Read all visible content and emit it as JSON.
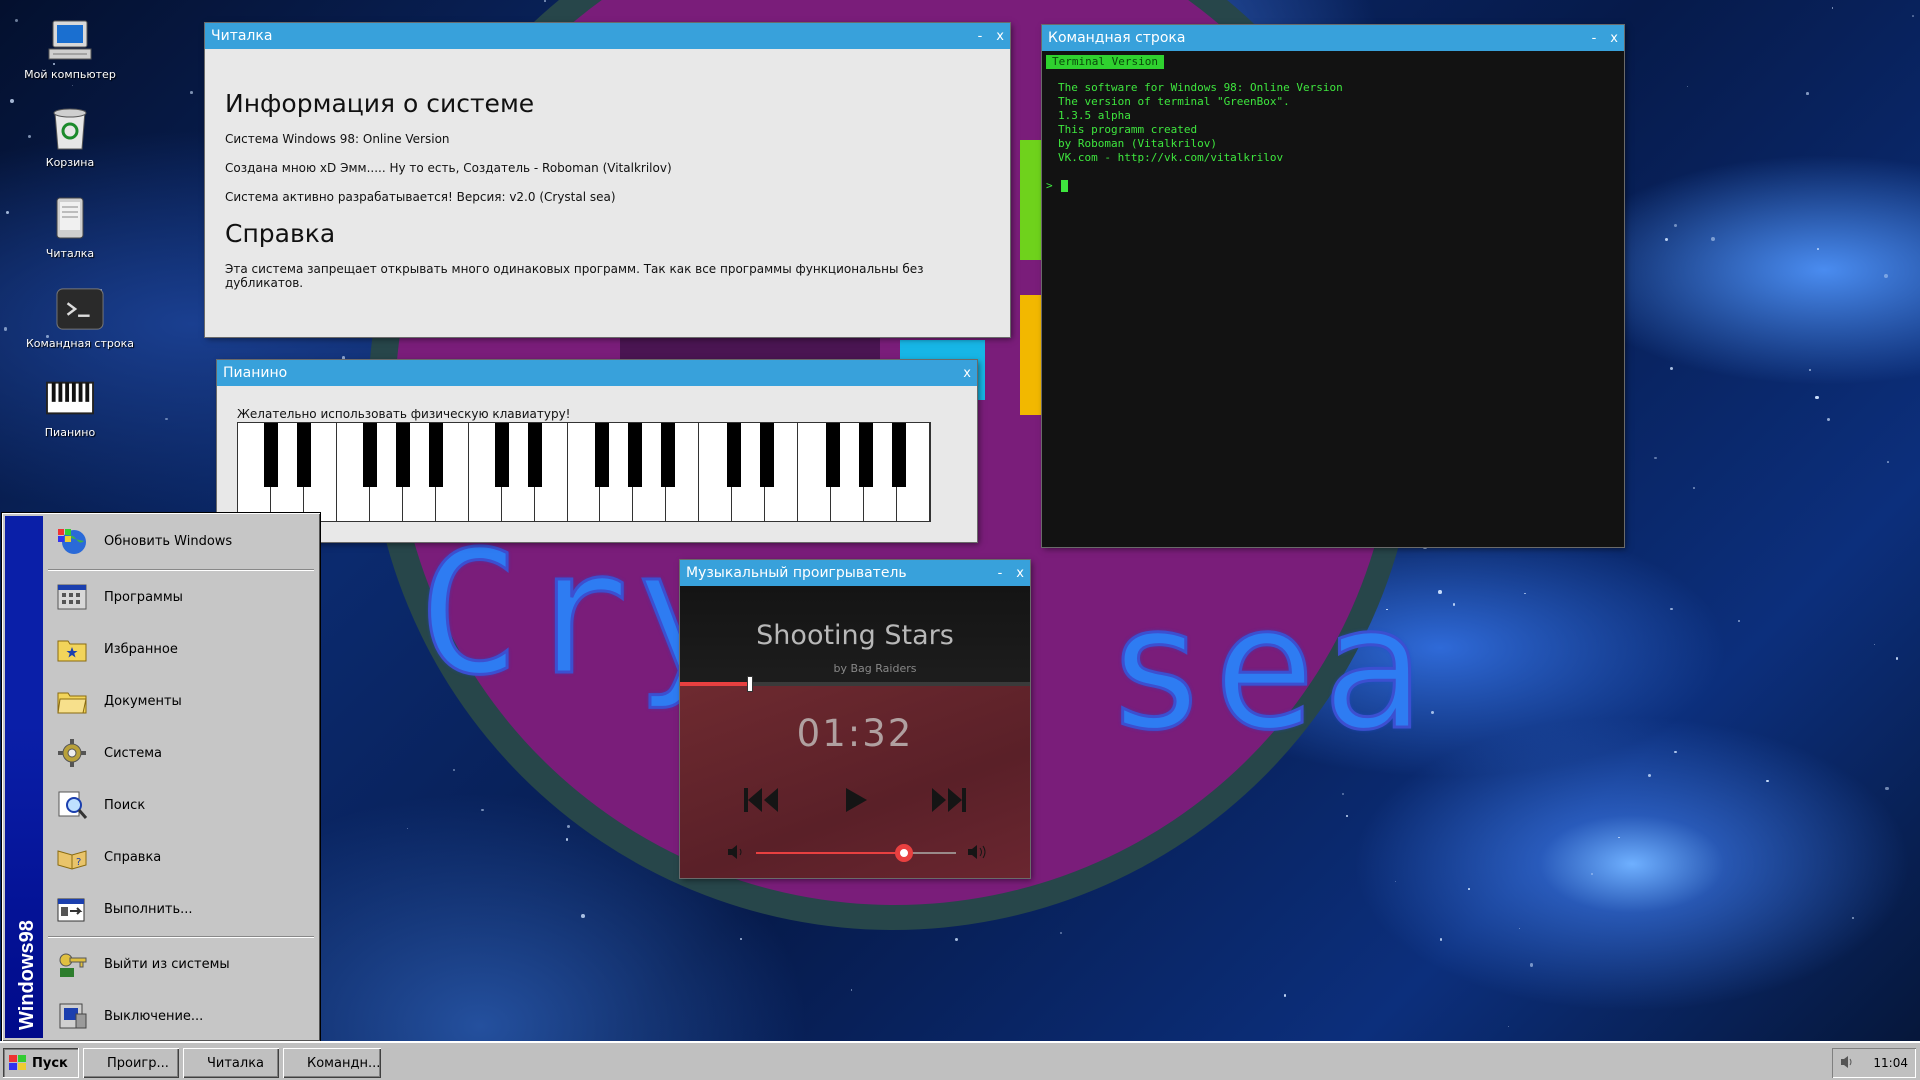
{
  "desktop": {
    "icons": [
      {
        "label": "Мой компьютер",
        "icon": "computer-icon"
      },
      {
        "label": "Корзина",
        "icon": "recycle-bin-icon"
      },
      {
        "label": "Читалка",
        "icon": "ebook-reader-icon"
      },
      {
        "label": "Командная строка",
        "icon": "terminal-icon"
      },
      {
        "label": "Пианино",
        "icon": "piano-icon"
      }
    ],
    "wallpaper_text_left": "Cry",
    "wallpaper_text_right": "sea"
  },
  "reader": {
    "title": "Читалка",
    "minimize": "-",
    "close": "x",
    "h1": "Информация о системе",
    "p1": "Система Windows 98: Online Version",
    "p2": "Создана мною xD Эмм..... Ну то есть, Создатель - Roboman (Vitalkrilov)",
    "p3": "Система активно разрабатывается! Версия: v2.0 (Crystal sea)",
    "h2": "Справка",
    "p4": "Эта система запрещает открывать много одинаковых программ. Так как все программы функциональны без дубликатов."
  },
  "terminal": {
    "title": "Командная строка",
    "minimize": "-",
    "close": "x",
    "tag": "Terminal Version",
    "lines": [
      "The software for Windows 98: Online Version",
      "The version of terminal \"GreenBox\".",
      "1.3.5 alpha",
      "This programm created",
      "by Roboman (Vitalkrilov)",
      "VK.com - http://vk.com/vitalkrilov"
    ],
    "prompt": ">"
  },
  "piano": {
    "title": "Пианино",
    "close": "x",
    "hint": "Желательно использовать физическую клавиатуру!"
  },
  "player": {
    "title": "Музыкальный проигрыватель",
    "minimize": "-",
    "close": "x",
    "song": "Shooting Stars",
    "artist": "by Bag Raiders",
    "time": "01:32",
    "progress": 0.2,
    "volume": 0.74,
    "accent": "#e84040"
  },
  "start_menu": {
    "brand": "Windows98",
    "items": [
      {
        "label": "Обновить Windows",
        "icon": "globe-update-icon"
      },
      {
        "label": "Программы",
        "icon": "programs-icon"
      },
      {
        "label": "Избранное",
        "icon": "favorites-folder-icon"
      },
      {
        "label": "Документы",
        "icon": "documents-folder-icon"
      },
      {
        "label": "Система",
        "icon": "settings-gear-icon"
      },
      {
        "label": "Поиск",
        "icon": "search-icon"
      },
      {
        "label": "Справка",
        "icon": "help-book-icon"
      },
      {
        "label": "Выполнить...",
        "icon": "run-icon"
      },
      {
        "label": "Выйти из системы",
        "icon": "logoff-key-icon"
      },
      {
        "label": "Выключение...",
        "icon": "shutdown-icon"
      }
    ]
  },
  "taskbar": {
    "start_label": "Пуск",
    "tasks": [
      "Проигр...",
      "Читалка",
      "Командн..."
    ],
    "clock": "11:04"
  }
}
